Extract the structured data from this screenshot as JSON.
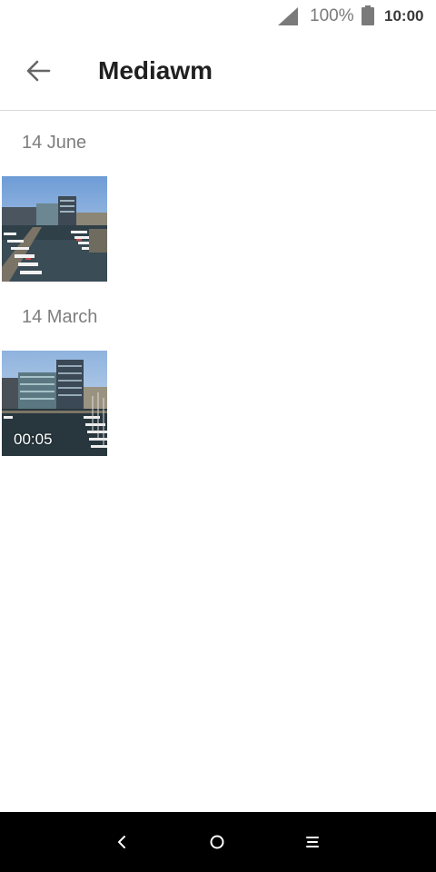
{
  "status_bar": {
    "battery_percent": "100%",
    "time": "10:00",
    "icons": [
      "signal-icon",
      "battery-icon"
    ]
  },
  "toolbar": {
    "title": "Mediawm",
    "back_icon": "arrow-back-icon"
  },
  "sections": [
    {
      "date": "14 June",
      "items": [
        {
          "type": "photo",
          "icon": "harbour-photo"
        }
      ]
    },
    {
      "date": "14 March",
      "items": [
        {
          "type": "video",
          "icon": "harbour-video",
          "duration": "00:05"
        }
      ]
    }
  ],
  "nav_bar": {
    "icons": [
      "back-nav-icon",
      "home-nav-icon",
      "menu-nav-icon"
    ]
  },
  "colors": {
    "background": "#ffffff",
    "title": "#202020",
    "date_label": "#7e7e7e",
    "nav_bar": "#000000"
  }
}
